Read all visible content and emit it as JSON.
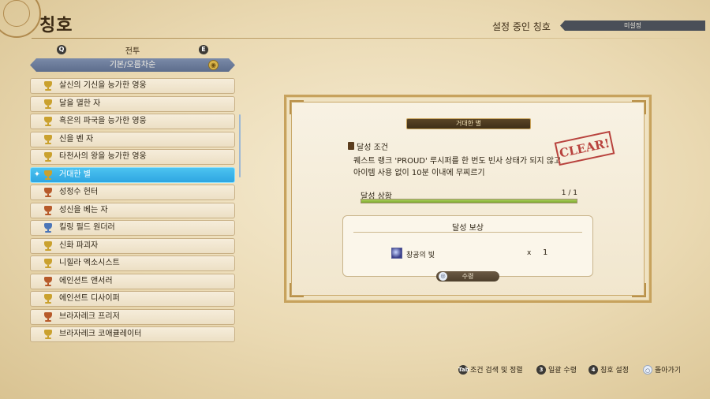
{
  "header": {
    "title": "칭호",
    "set_title_label": "설정 중인 칭호",
    "set_title_value": "미설정"
  },
  "category": {
    "left_key": "Q",
    "right_key": "E",
    "label": "전투",
    "sort_label": "기본/오름차순"
  },
  "title_list": [
    {
      "label": "살신의 기신을 능가한 영웅",
      "trophy": "gold"
    },
    {
      "label": "달을 멸한 자",
      "trophy": "gold"
    },
    {
      "label": "흑은의 파국을 능가한 영웅",
      "trophy": "gold"
    },
    {
      "label": "신을 벤 자",
      "trophy": "gold"
    },
    {
      "label": "타천사의 왕을 능가한 영웅",
      "trophy": "gold"
    },
    {
      "label": "거대한 별",
      "trophy": "gold",
      "selected": true
    },
    {
      "label": "성정수 헌터",
      "trophy": "bronze"
    },
    {
      "label": "성신을 베는 자",
      "trophy": "bronze"
    },
    {
      "label": "킬링 필드 원더러",
      "trophy": "silver"
    },
    {
      "label": "신화 파괴자",
      "trophy": "gold"
    },
    {
      "label": "니힐라 엑소시스트",
      "trophy": "gold"
    },
    {
      "label": "에인션트 앤서러",
      "trophy": "bronze"
    },
    {
      "label": "에인션트 디사이퍼",
      "trophy": "gold"
    },
    {
      "label": "브라자레크 프리저",
      "trophy": "bronze"
    },
    {
      "label": "브라자레크 코애큘레이터",
      "trophy": "gold"
    }
  ],
  "detail": {
    "title": "거대한 별",
    "condition_label": "달성 조건",
    "condition_text": "퀘스트 랭크 'PROUD' 루시퍼를 한 번도 빈사 상태가 되지 않고 아이템 사용 없이 10분 이내에 무찌르기",
    "stamp": "CLEAR!",
    "progress_label": "달성 상황",
    "progress_count": "1 / 1",
    "progress_fraction": 1.0,
    "reward_title": "달성 보상",
    "reward_name": "창공의 빛",
    "reward_x": "x",
    "reward_qty": "1",
    "claim_label": "수령"
  },
  "footer": {
    "search": {
      "key": "Tab",
      "label": "조건 검색 및 정렬"
    },
    "claim_all": {
      "key": "3",
      "label": "일괄 수령"
    },
    "set_title": {
      "key": "4",
      "label": "칭호 설정"
    },
    "back": {
      "key": "○",
      "label": "돌아가기"
    }
  },
  "colors": {
    "selected_row": "#2ea6e2",
    "progress_fill": "#7eab2f",
    "stamp": "#b8423d"
  }
}
